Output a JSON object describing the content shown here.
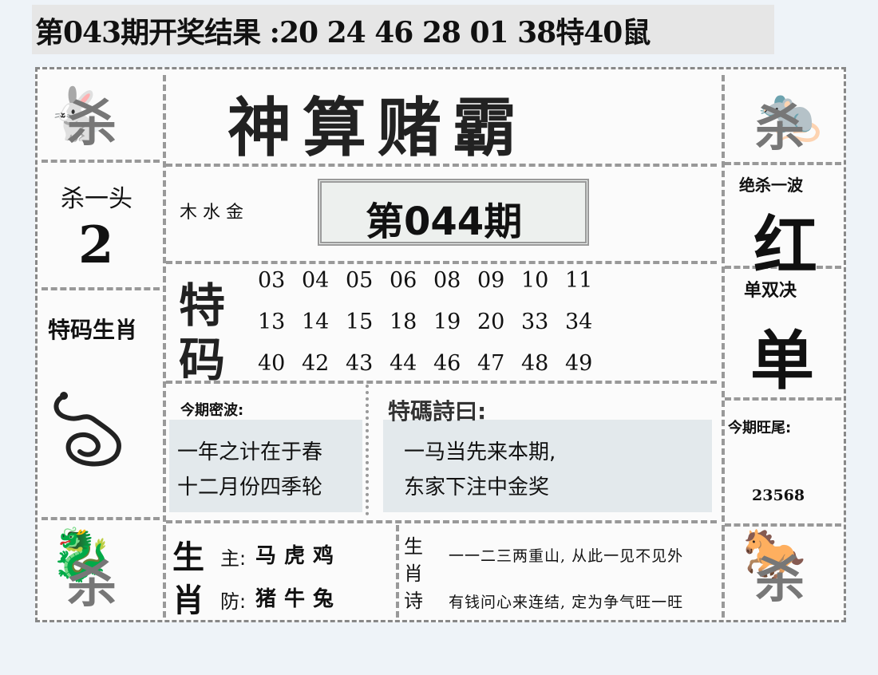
{
  "header": "第043期开奖结果 :20 24 46 28 01 38特40鼠",
  "title": "神算赌霸",
  "sha_label": "杀",
  "left": {
    "kill_head_label": "杀一头",
    "kill_head_value": "2",
    "special_zodiac_label": "特码生肖"
  },
  "center": {
    "elements": "木 水 金",
    "issue": "第044期",
    "te": "特",
    "ma": "码",
    "numbers": [
      [
        "03",
        "04",
        "05",
        "06",
        "08",
        "09",
        "10",
        "11"
      ],
      [
        "13",
        "14",
        "15",
        "18",
        "19",
        "20",
        "33",
        "34"
      ],
      [
        "40",
        "42",
        "43",
        "44",
        "46",
        "47",
        "48",
        "49"
      ]
    ],
    "riddle_label": "今期密波:",
    "riddle_lines": [
      "一年之计在于春",
      "十二月份四季轮"
    ],
    "poem_label": "特碼詩曰:",
    "poem_lines": [
      "一马当先来本期,",
      "东家下注中金奖"
    ]
  },
  "right": {
    "kill_wave_label": "绝杀一波",
    "kill_wave_value": "红",
    "odd_even_label": "单双决",
    "odd_even_value": "单",
    "tail_label": "今期旺尾:",
    "tail_value": "23568"
  },
  "bottom": {
    "sheng": "生",
    "xiao": "肖",
    "main_label": "主:",
    "main_animals": "马虎鸡",
    "guard_label": "防:",
    "guard_animals": "猪牛兔",
    "poem_title": [
      "生",
      "肖",
      "诗"
    ],
    "poem_lines": [
      "一一二三两重山, 从此一见不见外",
      "有钱问心来连结, 定为争气旺一旺"
    ]
  }
}
